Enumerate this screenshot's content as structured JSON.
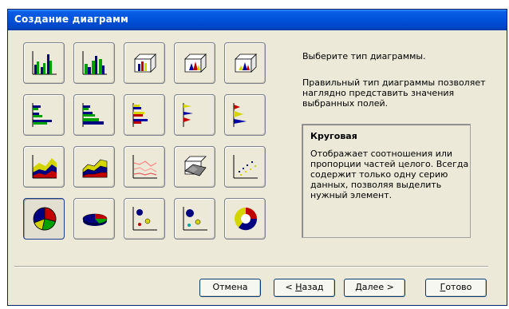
{
  "window": {
    "title": "Создание диаграмм"
  },
  "right_panel": {
    "prompt": "Выберите тип диаграммы.",
    "info_line1": "Правильный тип диаграммы позволяет",
    "info_line2": "наглядно представить значения",
    "info_line3": "выбранных полей.",
    "selected_type": "Круговая",
    "desc_line1": "Отображает соотношения или",
    "desc_line2": "пропорции частей целого. Всегда",
    "desc_line3": "содержит только одну серию",
    "desc_line4": "данных, позволяя выделить",
    "desc_line5": "нужный элемент."
  },
  "buttons": {
    "cancel": "Отмена",
    "back_prefix": "< ",
    "back_key": "Н",
    "back_rest": "азад",
    "next_key": "Д",
    "next_rest": "алее >",
    "finish_key": "Г",
    "finish_rest": "отово"
  },
  "chart_types": [
    "column-clustered-icon",
    "column-stacked-icon",
    "column-3d-icon",
    "column-3d-stacked-icon",
    "column-3d-deep-icon",
    "bar-clustered-icon",
    "bar-stacked-icon",
    "bar-3d-icon",
    "cone-bar-icon",
    "pyramid-bar-icon",
    "area-icon",
    "area-3d-icon",
    "line-icon",
    "surface-3d-icon",
    "scatter-icon",
    "pie-icon",
    "pie-3d-icon",
    "bubble-icon",
    "bubble-3d-icon",
    "doughnut-icon"
  ],
  "selected_index": 15,
  "colors": {
    "title_bar": "#0052d9",
    "dialog_bg": "#ece9d8",
    "selection_border": "#1a3d8f"
  }
}
